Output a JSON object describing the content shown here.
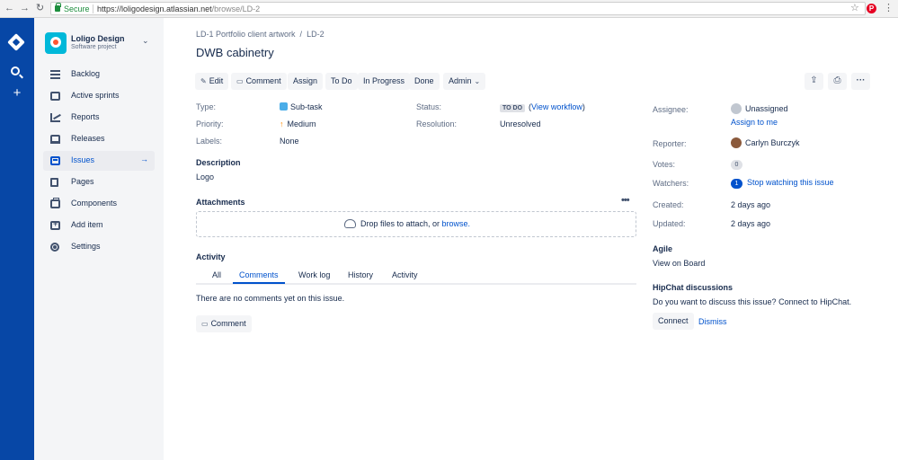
{
  "browser": {
    "secure_label": "Secure",
    "url_base": "https://loligodesign.atlassian.net",
    "url_path": "/browse/LD-2"
  },
  "project": {
    "name": "Loligo Design",
    "type": "Software project"
  },
  "sidebar": {
    "items": [
      {
        "label": "Backlog",
        "icon": "backlog-icon"
      },
      {
        "label": "Active sprints",
        "icon": "sprint-board-icon"
      },
      {
        "label": "Reports",
        "icon": "reports-icon"
      },
      {
        "label": "Releases",
        "icon": "releases-icon"
      },
      {
        "label": "Issues",
        "icon": "issues-icon",
        "active": true
      },
      {
        "label": "Pages",
        "icon": "pages-icon"
      },
      {
        "label": "Components",
        "icon": "components-icon"
      },
      {
        "label": "Add item",
        "icon": "add-item-icon"
      },
      {
        "label": "Settings",
        "icon": "settings-icon"
      }
    ]
  },
  "breadcrumb": {
    "parent": "LD-1 Portfolio client artwork",
    "separator": "/",
    "current": "LD-2"
  },
  "issue": {
    "title": "DWB cabinetry"
  },
  "toolbar": {
    "edit": "Edit",
    "comment": "Comment",
    "assign": "Assign",
    "todo": "To Do",
    "in_progress": "In Progress",
    "done": "Done",
    "admin": "Admin"
  },
  "details": {
    "type_label": "Type:",
    "type_value": "Sub-task",
    "priority_label": "Priority:",
    "priority_value": "Medium",
    "labels_label": "Labels:",
    "labels_value": "None",
    "status_label": "Status:",
    "status_value": "TO DO",
    "status_workflow_open": "(",
    "status_workflow_link": "View workflow",
    "status_workflow_close": ")",
    "resolution_label": "Resolution:",
    "resolution_value": "Unresolved"
  },
  "description": {
    "heading": "Description",
    "text": "Logo"
  },
  "attachments": {
    "heading": "Attachments",
    "drop_text": "Drop files to attach, or ",
    "browse_link": "browse."
  },
  "activity": {
    "heading": "Activity",
    "tabs": [
      "All",
      "Comments",
      "Work log",
      "History",
      "Activity"
    ],
    "active_tab": "Comments",
    "empty_text": "There are no comments yet on this issue.",
    "comment_button": "Comment"
  },
  "people": {
    "assignee_label": "Assignee:",
    "assignee_value": "Unassigned",
    "assign_to_me": "Assign to me",
    "reporter_label": "Reporter:",
    "reporter_value": "Carlyn Burczyk",
    "votes_label": "Votes:",
    "votes_count": "0",
    "watchers_label": "Watchers:",
    "watchers_count": "1",
    "watch_link": "Stop watching this issue"
  },
  "dates": {
    "created_label": "Created:",
    "created_value": "2 days ago",
    "updated_label": "Updated:",
    "updated_value": "2 days ago"
  },
  "agile": {
    "heading": "Agile",
    "link": "View on Board"
  },
  "hipchat": {
    "heading": "HipChat discussions",
    "text": "Do you want to discuss this issue? Connect to HipChat.",
    "connect": "Connect",
    "dismiss": "Dismiss"
  },
  "colors": {
    "global_nav": "#0747a6",
    "link": "#0052cc",
    "sidebar_bg": "#f4f5f7"
  }
}
